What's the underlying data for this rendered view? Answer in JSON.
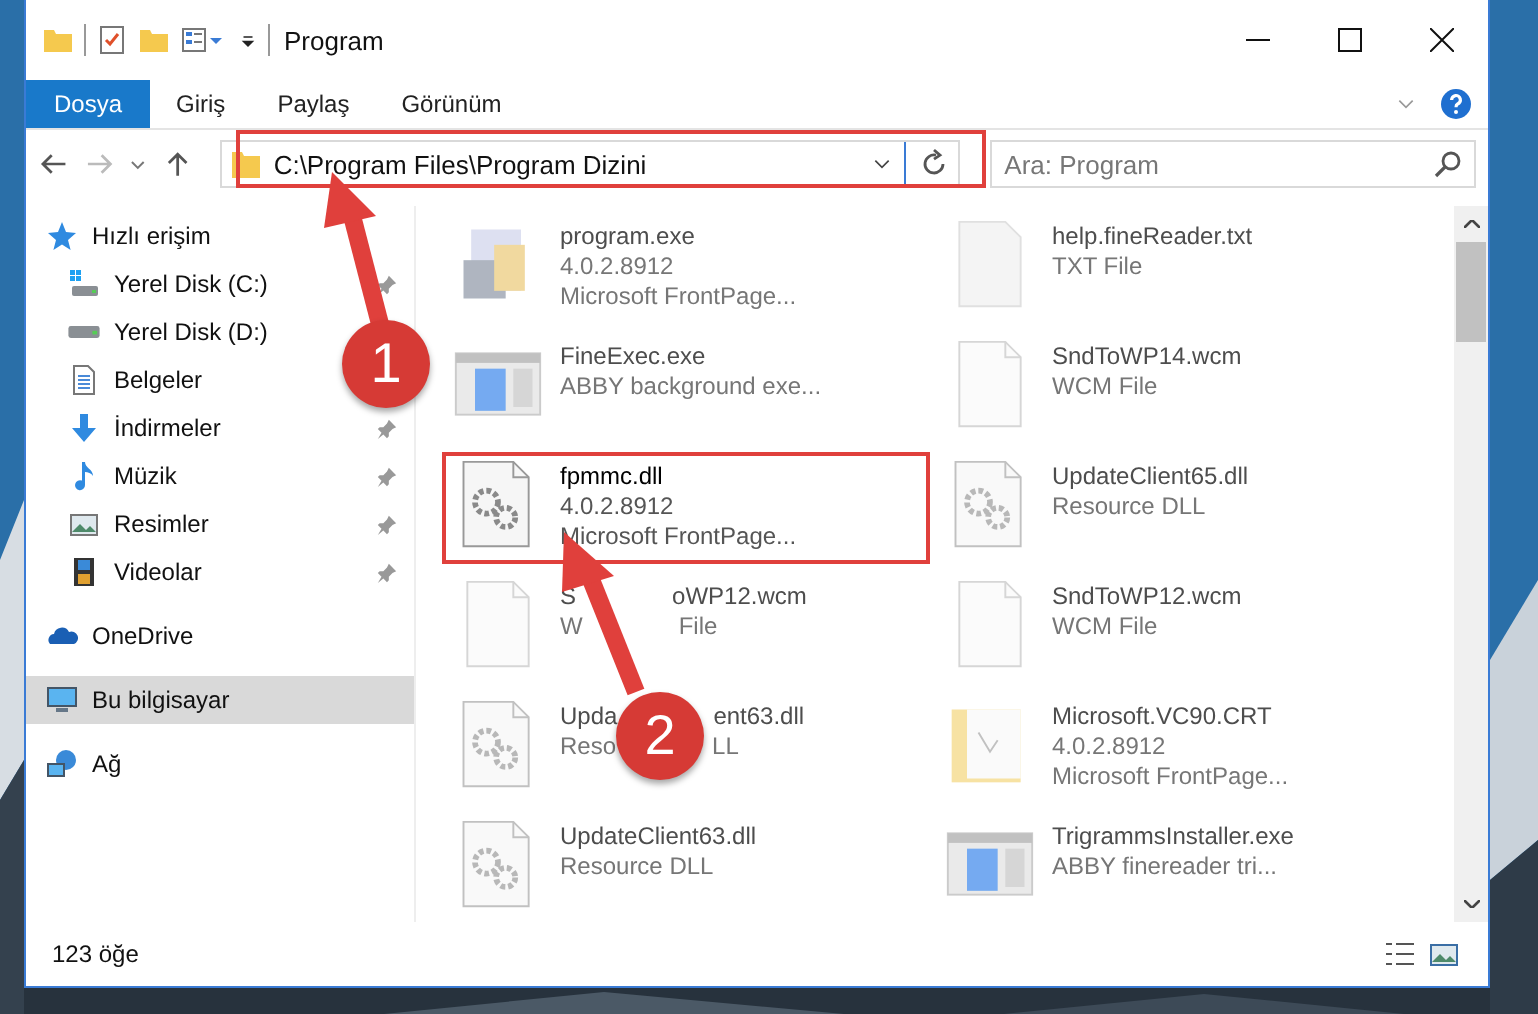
{
  "window": {
    "title": "Program"
  },
  "ribbon_tabs": [
    {
      "label": "Dosya",
      "selected": true
    },
    {
      "label": "Giriş",
      "selected": false
    },
    {
      "label": "Paylaş",
      "selected": false
    },
    {
      "label": "Görünüm",
      "selected": false
    }
  ],
  "address_bar": {
    "path": "C:\\Program Files\\Program Dizini"
  },
  "search": {
    "placeholder": "Ara: Program"
  },
  "sidebar": {
    "items": [
      {
        "label": "Hızlı erişim",
        "kind": "star",
        "selected": false,
        "children": [
          {
            "label": "Yerel Disk (C:)",
            "kind": "drive-windows",
            "selected": false,
            "pinned": true
          },
          {
            "label": "Yerel Disk (D:)",
            "kind": "drive",
            "selected": false
          },
          {
            "label": "Belgeler",
            "kind": "document",
            "selected": false
          },
          {
            "label": "İndirmeler",
            "kind": "download",
            "selected": false,
            "pinned": true
          },
          {
            "label": "Müzik",
            "kind": "music",
            "selected": false,
            "pinned": true
          },
          {
            "label": "Resimler",
            "kind": "pictures",
            "selected": false,
            "pinned": true
          },
          {
            "label": "Videolar",
            "kind": "video",
            "selected": false,
            "pinned": true
          }
        ]
      },
      {
        "label": "OneDrive",
        "kind": "cloud",
        "selected": false
      },
      {
        "label": "Bu bilgisayar",
        "kind": "computer",
        "selected": true
      },
      {
        "label": "Ağ",
        "kind": "network",
        "selected": false
      }
    ]
  },
  "files": [
    {
      "kind": "app",
      "name": [
        "program.exe"
      ],
      "details": [
        [
          "4.0.2.8912"
        ],
        [
          "Microsoft FrontPage..."
        ]
      ],
      "blurred": true,
      "annotated": false
    },
    {
      "kind": "text",
      "name": [
        "help.fineReader.txt"
      ],
      "details": [
        [
          "TXT File"
        ]
      ],
      "blurred": true,
      "annotated": false
    },
    {
      "kind": "window",
      "name": [
        "FineExec.exe"
      ],
      "details": [
        [
          "ABBY background exe..."
        ]
      ],
      "blurred": true,
      "annotated": false
    },
    {
      "kind": "blank",
      "name": [
        "SndToWP14.wcm"
      ],
      "details": [
        [
          "WCM File"
        ]
      ],
      "blurred": true,
      "annotated": false
    },
    {
      "kind": "gears",
      "name": [
        "fpmmc.dll"
      ],
      "details": [
        [
          "4.0.2.8912"
        ],
        [
          "Microsoft FrontPage..."
        ]
      ],
      "blurred": false,
      "annotated": true
    },
    {
      "kind": "gears",
      "name": [
        "UpdateClient65.dll"
      ],
      "details": [
        [
          "Resource DLL"
        ]
      ],
      "blurred": true,
      "annotated": false
    },
    {
      "kind": "blank",
      "name": [
        "S",
        "oWP12.wcm"
      ],
      "details": [
        [
          "W",
          "File"
        ]
      ],
      "blurred": true,
      "annotated": false
    },
    {
      "kind": "blank",
      "name": [
        "SndToWP12.wcm"
      ],
      "details": [
        [
          "WCM File"
        ]
      ],
      "blurred": true,
      "annotated": false
    },
    {
      "kind": "gears",
      "name": [
        "Upda",
        "ent63.dll"
      ],
      "details": [
        [
          "Reso",
          "LL"
        ]
      ],
      "blurred": true,
      "annotated": false
    },
    {
      "kind": "folder",
      "name": [
        "Microsoft.VC90.CRT"
      ],
      "details": [
        [
          "4.0.2.8912"
        ],
        [
          "Microsoft FrontPage..."
        ]
      ],
      "blurred": true,
      "annotated": false
    },
    {
      "kind": "gears",
      "name": [
        "UpdateClient63.dll"
      ],
      "details": [
        [
          "Resource DLL"
        ]
      ],
      "blurred": true,
      "annotated": false
    },
    {
      "kind": "window",
      "name": [
        "TrigrammsInstaller.exe"
      ],
      "details": [
        [
          "ABBY finereader tri..."
        ]
      ],
      "blurred": true,
      "annotated": false
    }
  ],
  "status_bar": {
    "item_count": "123 öğe"
  },
  "callouts": [
    {
      "number": "1"
    },
    {
      "number": "2"
    }
  ]
}
